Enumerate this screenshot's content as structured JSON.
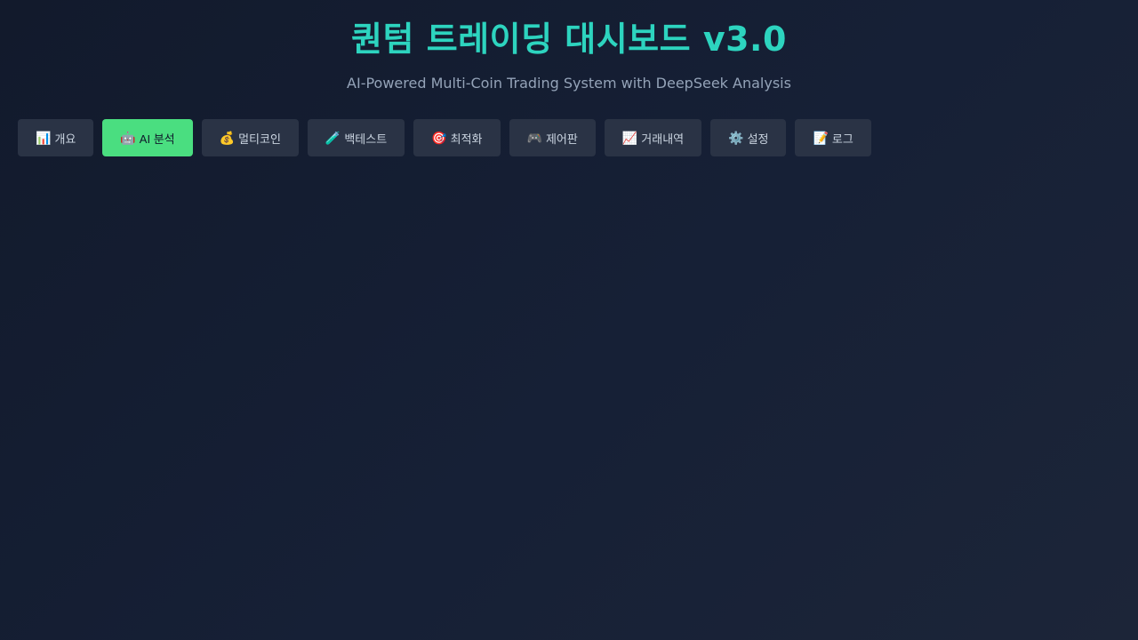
{
  "header": {
    "title": "퀀텀 트레이딩 대시보드 v3.0",
    "subtitle": "AI-Powered Multi-Coin Trading System with DeepSeek Analysis"
  },
  "tabs": [
    {
      "icon": "📊",
      "icon_name": "bar-chart-icon",
      "label": "개요",
      "active": false
    },
    {
      "icon": "🤖",
      "icon_name": "robot-icon",
      "label": "AI 분석",
      "active": true
    },
    {
      "icon": "💰",
      "icon_name": "money-bag-icon",
      "label": "멀티코인",
      "active": false
    },
    {
      "icon": "🧪",
      "icon_name": "test-tube-icon",
      "label": "백테스트",
      "active": false
    },
    {
      "icon": "🎯",
      "icon_name": "target-icon",
      "label": "최적화",
      "active": false
    },
    {
      "icon": "🎮",
      "icon_name": "game-controller-icon",
      "label": "제어판",
      "active": false
    },
    {
      "icon": "📈",
      "icon_name": "trend-up-icon",
      "label": "거래내역",
      "active": false
    },
    {
      "icon": "⚙️",
      "icon_name": "gear-icon",
      "label": "설정",
      "active": false
    },
    {
      "icon": "📝",
      "icon_name": "memo-icon",
      "label": "로그",
      "active": false
    }
  ],
  "colors": {
    "accent_title": "#2dd4bf",
    "active_tab": "#4ade80",
    "tab_background": "#2a3345"
  }
}
